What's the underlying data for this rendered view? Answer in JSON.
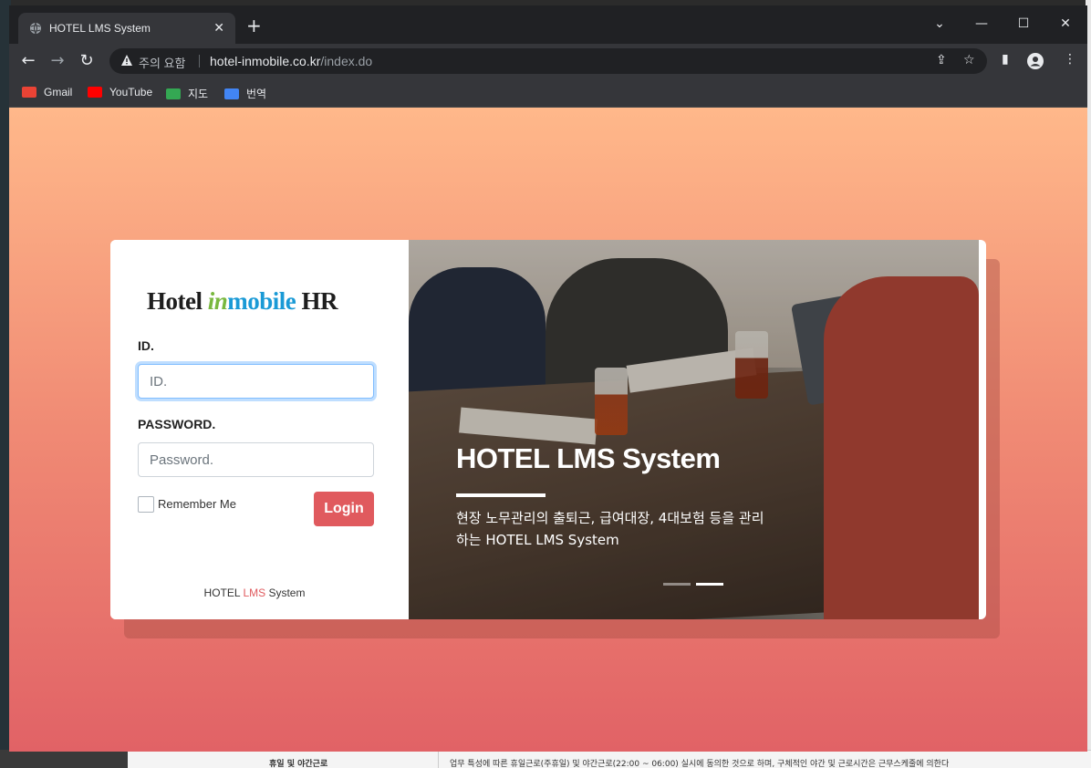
{
  "browser": {
    "tab_title": "HOTEL LMS System",
    "new_tab_symbol": "+",
    "security_label": "주의 요함",
    "url_host": "hotel-inmobile.co.kr",
    "url_path": "/index.do",
    "bookmarks": [
      {
        "label": "Gmail",
        "color": "#ea4335"
      },
      {
        "label": "YouTube",
        "color": "#ff0000"
      },
      {
        "label": "지도",
        "color": "#34a853"
      },
      {
        "label": "번역",
        "color": "#4285f4"
      }
    ]
  },
  "login": {
    "logo": {
      "hotel": "Hotel",
      "in": "in",
      "mobile": "mobile",
      "hr": "HR"
    },
    "id_label": "ID.",
    "id_placeholder": "ID.",
    "password_label": "PASSWORD.",
    "password_placeholder": "Password.",
    "remember_label": "Remember Me",
    "login_button": "Login",
    "footer": {
      "part1": "HOTEL ",
      "accent": "LMS",
      "part2": " System"
    }
  },
  "hero": {
    "title": "HOTEL LMS System",
    "description": "현장 노무관리의 출퇴근, 급여대장, 4대보험 등을 관리 하는 HOTEL LMS System",
    "slide_count": 2,
    "active_slide": 2
  },
  "background_doc": {
    "cell_label": "휴일 및 야간근로",
    "cell_text": "업무 특성에 따른 휴일근로(주휴일) 및 야간근로(22:00 ~ 06:00) 실시에 동의한 것으로 하며, 구체적인 야간 및 근로시간은 근무스케줄에 의한다"
  },
  "colors": {
    "accent": "#e05a5e",
    "gradient_top": "#ffb88a",
    "gradient_bottom": "#e16266",
    "logo_green": "#79b83f",
    "logo_blue": "#1a9ad6"
  }
}
